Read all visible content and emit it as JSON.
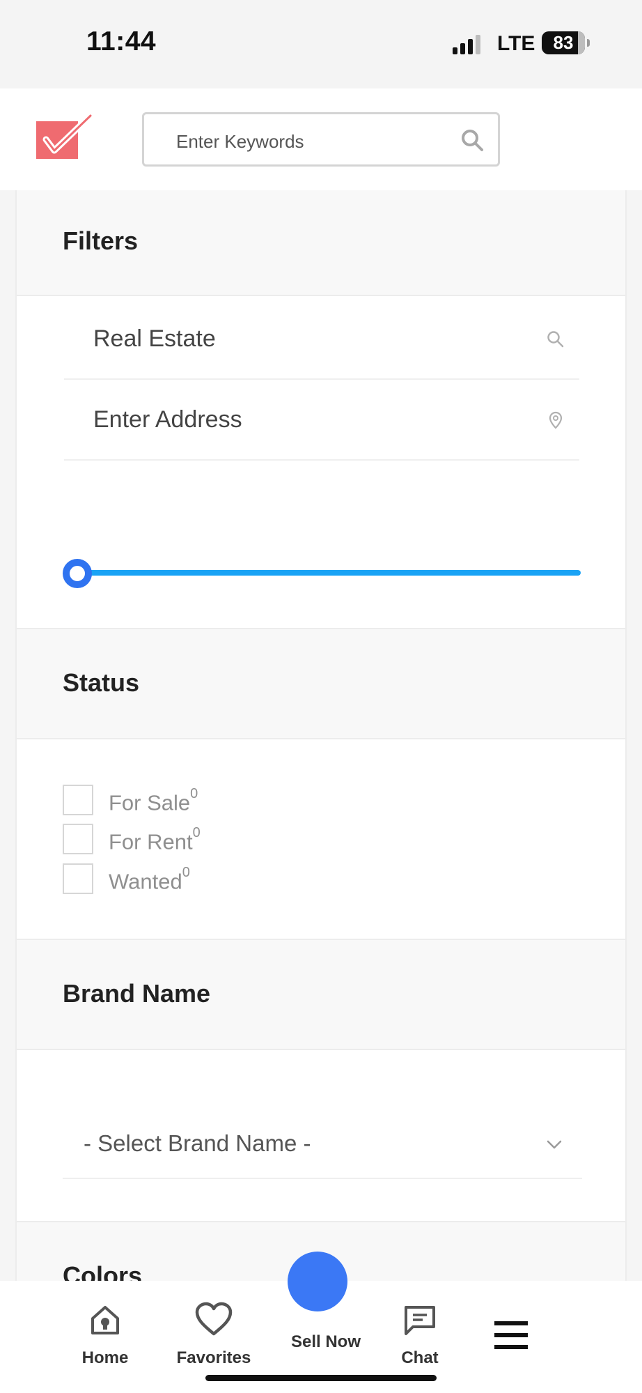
{
  "status_bar": {
    "time": "11:44",
    "network": "LTE",
    "battery": "83"
  },
  "header": {
    "search_placeholder": "Enter Keywords",
    "logo_icon": "checkmark-logo-icon",
    "search_icon": "search-icon"
  },
  "filters": {
    "title": "Filters",
    "category_value": "Real Estate",
    "address_placeholder": "Enter Address",
    "slider_value_fraction": 0
  },
  "status": {
    "title": "Status",
    "options": [
      {
        "label": "For Sale",
        "count": "0",
        "checked": false
      },
      {
        "label": "For Rent",
        "count": "0",
        "checked": false
      },
      {
        "label": "Wanted",
        "count": "0",
        "checked": false
      }
    ]
  },
  "brand": {
    "title": "Brand Name",
    "select_value": "- Select Brand Name -"
  },
  "colors": {
    "title": "Colors"
  },
  "bottom_nav": {
    "home": "Home",
    "favorites": "Favorites",
    "sell_now": "Sell Now",
    "chat": "Chat"
  },
  "theme": {
    "accent": "#3b78f5",
    "slider": "#1aa3f5",
    "logo": "#ef6b70"
  }
}
